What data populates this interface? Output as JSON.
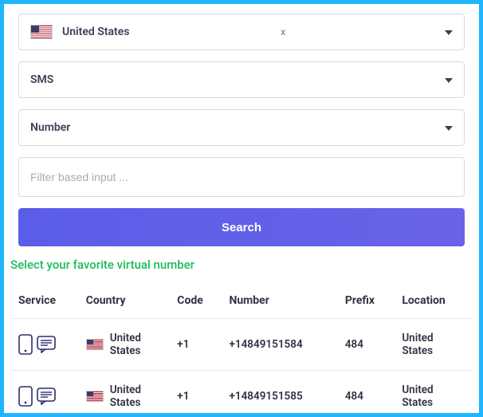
{
  "filters": {
    "country": {
      "label": "United States",
      "clear": "x"
    },
    "service": {
      "label": "SMS"
    },
    "type": {
      "label": "Number"
    },
    "text_input": {
      "placeholder": "Filter based input ..."
    },
    "search_label": "Search"
  },
  "subtitle": "Select your favorite virtual number",
  "table": {
    "headers": {
      "service": "Service",
      "country": "Country",
      "code": "Code",
      "number": "Number",
      "prefix": "Prefix",
      "location": "Location"
    },
    "rows": [
      {
        "country": "United States",
        "code": "+1",
        "number": "+14849151584",
        "prefix": "484",
        "location": "United States"
      },
      {
        "country": "United States",
        "code": "+1",
        "number": "+14849151585",
        "prefix": "484",
        "location": "United States"
      }
    ]
  }
}
